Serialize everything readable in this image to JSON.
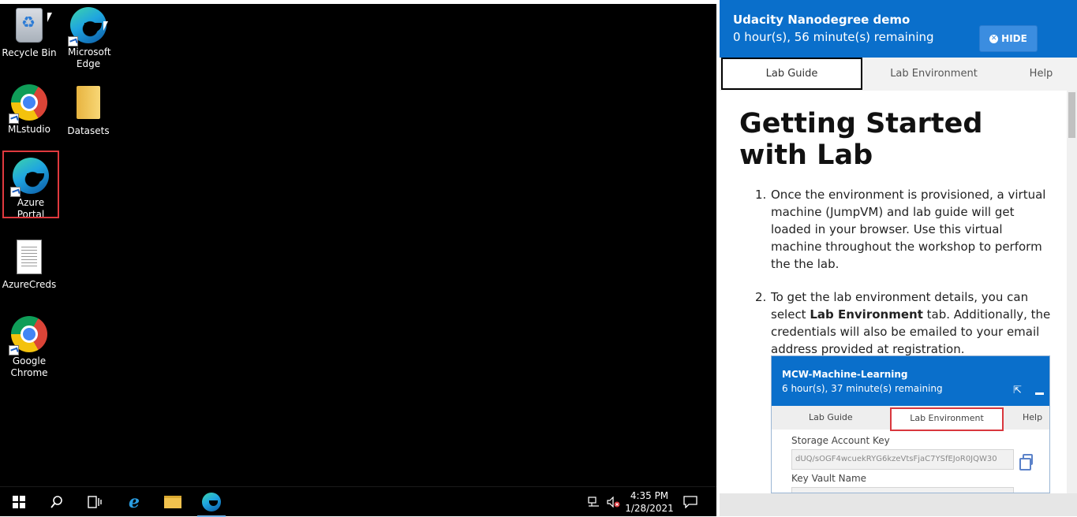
{
  "desktop": {
    "icons": [
      {
        "label": "Recycle Bin",
        "icon": "recycle-bin-icon"
      },
      {
        "label": "Microsoft Edge",
        "icon": "edge-icon"
      },
      {
        "label": "MLstudio",
        "icon": "chrome-icon"
      },
      {
        "label": "Datasets",
        "icon": "folder-icon"
      },
      {
        "label": "Azure Portal",
        "icon": "edge-icon"
      },
      {
        "label": "AzureCreds",
        "icon": "text-document-icon"
      },
      {
        "label": "Google Chrome",
        "icon": "chrome-icon"
      }
    ],
    "selected_icon": "Azure Portal"
  },
  "taskbar": {
    "items": [
      "start-icon",
      "search-icon",
      "task-view-icon",
      "internet-explorer-icon",
      "file-explorer-icon",
      "edge-icon"
    ],
    "tray_icons": [
      "network-icon",
      "volume-muted-icon"
    ],
    "time": "4:35 PM",
    "date": "1/28/2021",
    "notification_icon": "notification-icon"
  },
  "lab_panel": {
    "title": "Udacity Nanodegree demo",
    "remaining": "0 hour(s), 56 minute(s) remaining",
    "hide_label": "HIDE",
    "accent_color": "#0a6fcb",
    "tabs": [
      {
        "label": "Lab Guide",
        "active": true
      },
      {
        "label": "Lab Environment",
        "active": false
      },
      {
        "label": "Help",
        "active": false
      }
    ],
    "heading": "Getting Started with Lab",
    "steps": [
      {
        "num": "1.",
        "text": "Once the environment is provisioned, a virtual machine (JumpVM) and lab guide will get loaded in your browser. Use this virtual machine throughout the workshop to perform the the lab."
      },
      {
        "num": "2.",
        "text_before": "To get the lab environment details, you can select ",
        "bold": "Lab Environment",
        "text_after": " tab. Additionally, the credentials will also be emailed to your email address provided at registration."
      }
    ],
    "embedded_screenshot": {
      "title": "MCW-Machine-Learning",
      "remaining": "6 hour(s), 37 minute(s) remaining",
      "tabs": [
        "Lab Guide",
        "Lab Environment",
        "Help"
      ],
      "highlighted_tab": "Lab Environment",
      "storage_label": "Storage Account Key",
      "storage_value": "dUQ/sOGF4wcuekRYG6kzeVtsFjaC7YSfEJoR0JQW30",
      "keyvault_label": "Key Vault Name"
    }
  }
}
